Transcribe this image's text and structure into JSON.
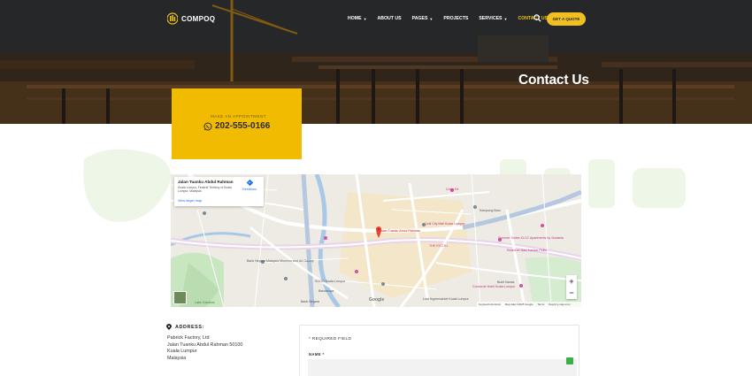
{
  "brand": {
    "name": "COMPOQ",
    "accent": "#f0c020"
  },
  "nav": {
    "items": [
      {
        "label": "HOME",
        "dropdown": true,
        "active": false
      },
      {
        "label": "ABOUT US",
        "dropdown": false,
        "active": false
      },
      {
        "label": "PAGES",
        "dropdown": true,
        "active": false
      },
      {
        "label": "PROJECTS",
        "dropdown": false,
        "active": false
      },
      {
        "label": "SERVICES",
        "dropdown": true,
        "active": false
      },
      {
        "label": "CONTACT US",
        "dropdown": false,
        "active": true
      }
    ],
    "search_icon": "search-icon",
    "cta_label": "GET A QUOTE"
  },
  "hero": {
    "title": "Contact Us"
  },
  "appointment": {
    "label": "MAKE AN APPOINTMENT",
    "phone": "202-555-0166",
    "icon": "whatsapp-icon"
  },
  "map": {
    "card": {
      "title": "Jalan Tuanku Abdul Rahman",
      "address": "Kuala Lumpur, Federal Territory of Kuala Lumpur, Malaysia",
      "larger_map_link": "View larger map",
      "directions_label": "Directions"
    },
    "marker_label": "Jalan Tuanku Abdul Rahman",
    "places": {
      "bukit_nanas": "Bukit Nanas",
      "kampung_baru": "Kampung Baru",
      "bank_negara": "Bank Negara",
      "bandaraya": "Bandaraya",
      "sogo": "SOGO Kuala Lumpur",
      "the_ritz": "THE RITZ KL",
      "muzium": "Bank Negara Malaysia Museum and Art Gallery",
      "quill": "Quill City Mall Kuala Lumpur",
      "summer": "Summer Suites KLCC Apartments by Soulasia",
      "restoran": "Restoran Nasi Kandar Pelita",
      "concorde": "Concorde Hotel Kuala Lumpur",
      "hyper": "Lulu Hypermarket Kuala Lumpur",
      "jalan_tun": "Jalan Tun Perak",
      "medan": "Medan Tuanku",
      "sultan": "Sultan Ismail",
      "chow_kit": "Chow Kit",
      "lake": "Lake Gardens",
      "up_the_creek": "Raja Laut"
    },
    "zoom_in": "+",
    "zoom_out": "−",
    "footer": {
      "shortcuts": "Keyboard shortcuts",
      "data": "Map data ©2025 Google",
      "terms": "Terms",
      "report": "Report a map error"
    },
    "google": "Google"
  },
  "address": {
    "title": "ADDRESS:",
    "lines": [
      "Pabrick Factory, Ltd",
      "Jalan Tuanku Abdul Rahman 50100",
      "Kuala Lumpur",
      "Malaysia"
    ]
  },
  "form": {
    "required_note": "* REQUIRED FIELD",
    "name_label": "NAME *",
    "name_value": ""
  }
}
